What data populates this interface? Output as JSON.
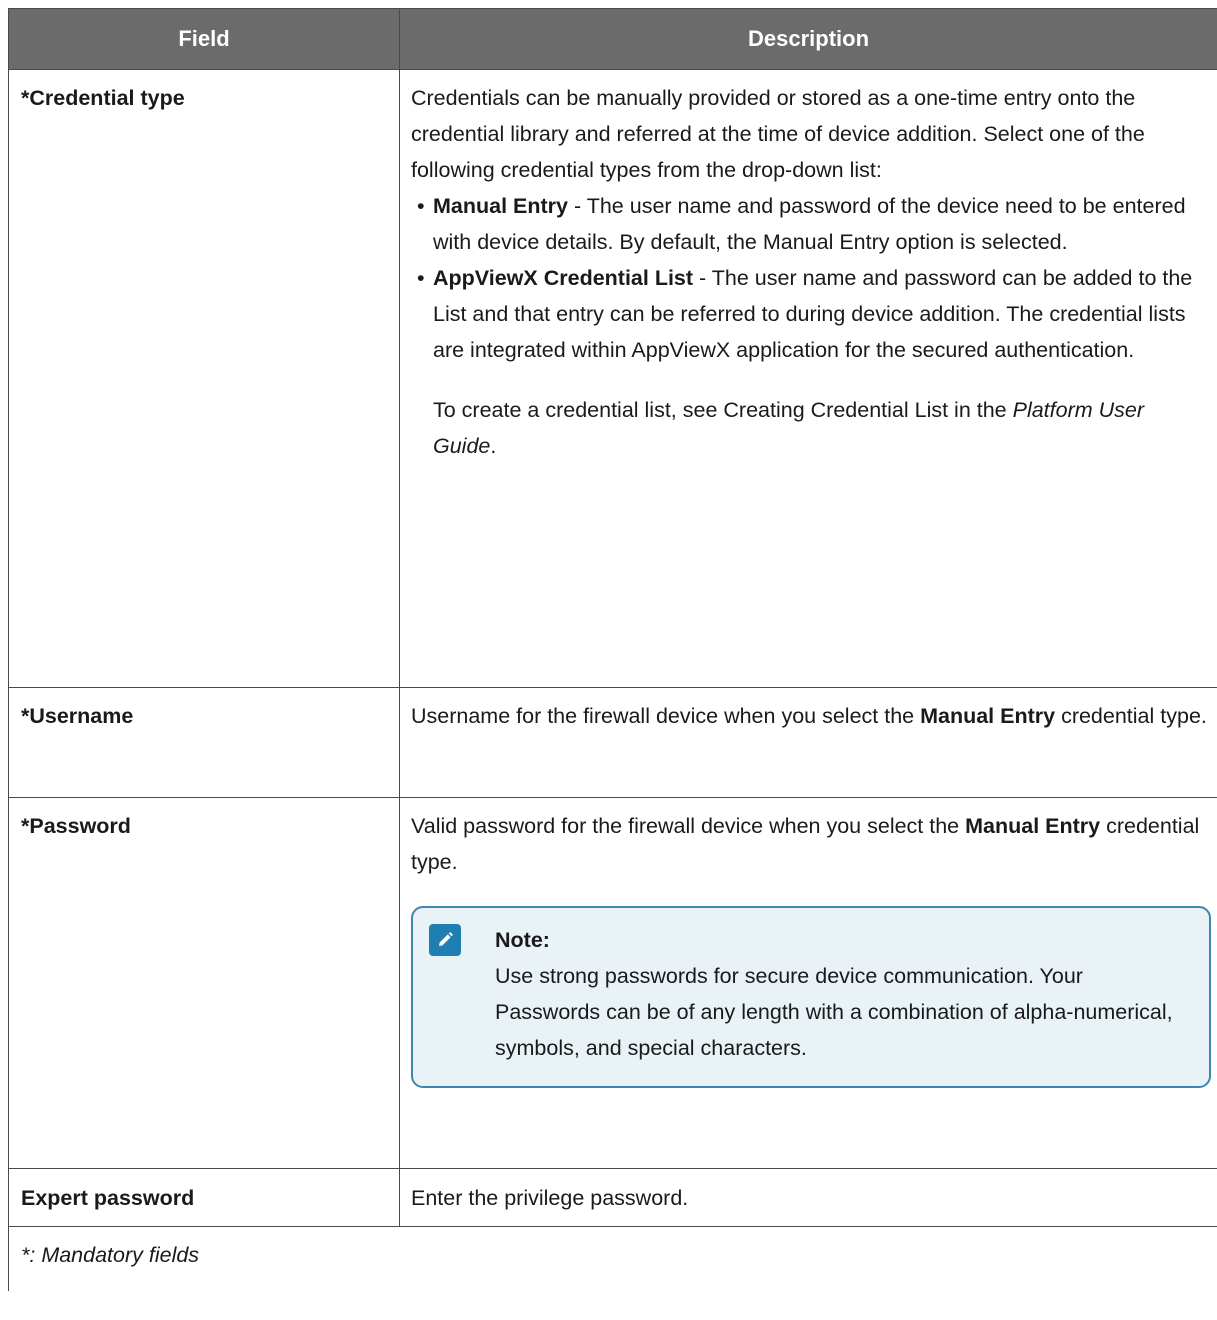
{
  "table": {
    "headers": {
      "field": "Field",
      "description": "Description"
    },
    "rows": [
      {
        "field": "*Credential type",
        "intro": "Credentials can be manually provided or stored as a one-time entry onto the credential library and referred at the time of device addition. Select one of the following credential types from the drop-down list:",
        "bullets": [
          {
            "term": "Manual Entry",
            "text": " - The user name and password of the device need to be entered with device details. By default, the Manual Entry option is selected."
          },
          {
            "term": "AppViewX Credential List",
            "text": " - The user name and password can be added to the List and that entry can be referred to during device addition. The credential lists are integrated within AppViewX application for the secured authentication."
          }
        ],
        "sub_para_text": "To create a credential list, see Creating Credential List in the ",
        "sub_para_italic": "Platform User Guide",
        "sub_para_end": "."
      },
      {
        "field": "*Username",
        "desc_prefix": "Username for the firewall device when you select the ",
        "desc_bold": "Manual Entry",
        "desc_suffix": " credential type."
      },
      {
        "field": "*Password",
        "desc_prefix": "Valid password for the firewall device when you select the ",
        "desc_bold": "Manual Entry",
        "desc_suffix": " credential type.",
        "note": {
          "title": "Note:",
          "body": "Use strong passwords for secure device communication. Your Passwords can be of any length with a combination of alpha-numerical, symbols, and special characters."
        }
      },
      {
        "field": "Expert password",
        "description": "Enter the privilege password."
      }
    ],
    "footer": "*: Mandatory fields"
  },
  "colors": {
    "header_bg": "#6b6b6b",
    "note_border": "#3d86b0",
    "note_bg": "#e9f2f6",
    "note_icon": "#1f7fb2"
  },
  "icons": {
    "note": "pencil-icon"
  }
}
